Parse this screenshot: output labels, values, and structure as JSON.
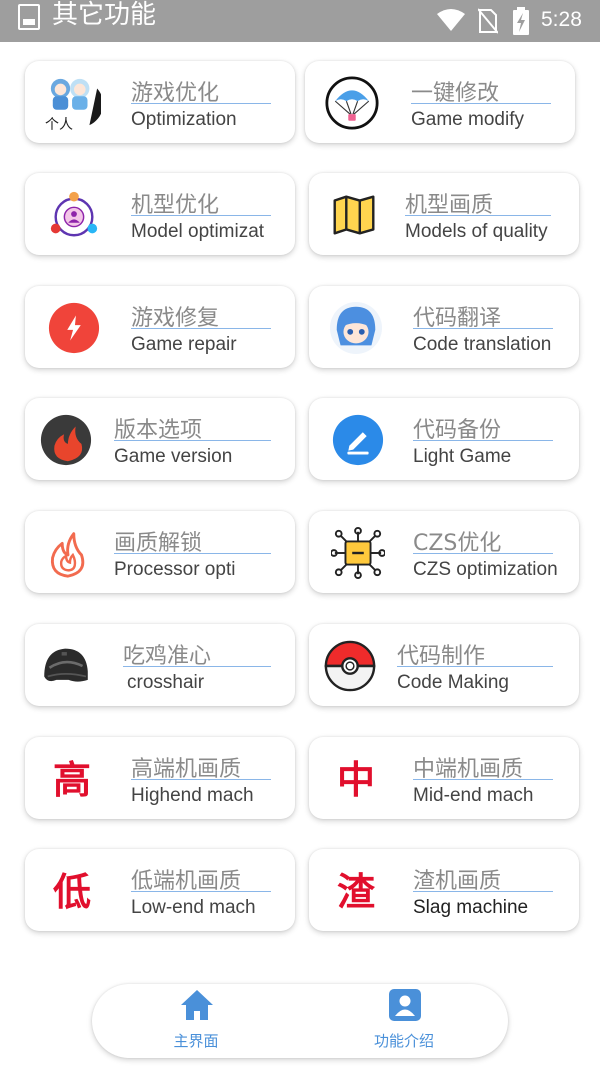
{
  "status_bar": {
    "title": "其它功能",
    "time": "5:28"
  },
  "cards": [
    {
      "title": "游戏优化",
      "subtitle": "Optimization",
      "icon": "anime-avatar-icon",
      "icon_label": "个人"
    },
    {
      "title": "一键修改",
      "subtitle": "Game modify",
      "icon": "parachute-icon"
    },
    {
      "title": "机型优化",
      "subtitle": "Model optimizat",
      "icon": "user-network-icon"
    },
    {
      "title": "机型画质",
      "subtitle": "Models of quality",
      "icon": "map-icon"
    },
    {
      "title": "游戏修复",
      "subtitle": "Game repair",
      "icon": "lightning-icon"
    },
    {
      "title": "代码翻译",
      "subtitle": "Code translation",
      "icon": "anime-girl-icon"
    },
    {
      "title": "版本选项",
      "subtitle": "Game version",
      "icon": "flame-dark-icon"
    },
    {
      "title": "代码备份",
      "subtitle": "Light Game",
      "icon": "edit-pen-icon"
    },
    {
      "title": "画质解锁",
      "subtitle": "Processor opti",
      "icon": "fire-outline-icon"
    },
    {
      "title": "CZS优化",
      "subtitle": "CZS optimization",
      "icon": "network-chip-icon"
    },
    {
      "title": "吃鸡准心",
      "subtitle": "crosshair",
      "icon": "helmet-icon"
    },
    {
      "title": "代码制作",
      "subtitle": "Code Making",
      "icon": "pokeball-icon"
    },
    {
      "title": "高端机画质",
      "subtitle": "Highend mach",
      "icon": "char-high-icon",
      "glyph": "高"
    },
    {
      "title": "中端机画质",
      "subtitle": "Mid-end mach",
      "icon": "char-mid-icon",
      "glyph": "中"
    },
    {
      "title": "低端机画质",
      "subtitle": "Low-end mach",
      "icon": "char-low-icon",
      "glyph": "低"
    },
    {
      "title": "渣机画质",
      "subtitle": "Slag machine",
      "icon": "char-slag-icon",
      "glyph": "渣"
    }
  ],
  "bottom_nav": {
    "home_label": "主界面",
    "features_label": "功能介绍"
  },
  "colors": {
    "status_bar": "#9e9e9e",
    "accent_blue": "#4a90d9",
    "red": "#e10f2d",
    "title_gray": "#8a8a8a"
  }
}
